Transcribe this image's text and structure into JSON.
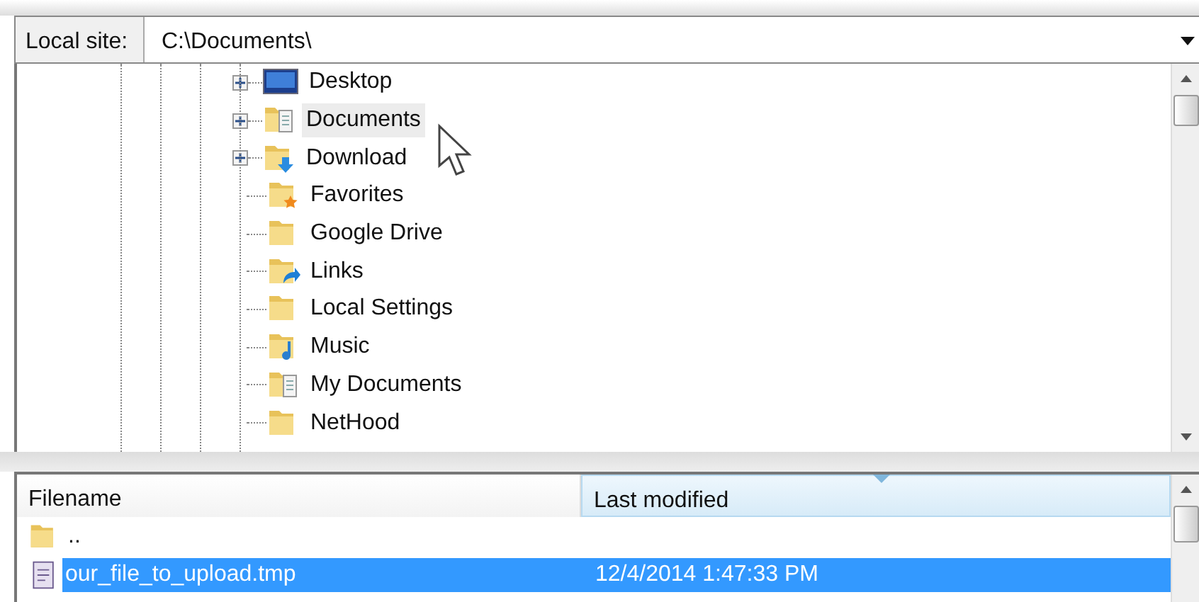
{
  "site_bar": {
    "label": "Local site:",
    "path": "C:\\Documents\\"
  },
  "tree": {
    "items": [
      {
        "label": "Desktop",
        "kind": "desktop",
        "expandable": true,
        "hovered": false
      },
      {
        "label": "Documents",
        "kind": "documents",
        "expandable": true,
        "hovered": true
      },
      {
        "label": "Download",
        "kind": "download",
        "expandable": true,
        "hovered": false
      },
      {
        "label": "Favorites",
        "kind": "star",
        "expandable": false,
        "hovered": false
      },
      {
        "label": "Google Drive",
        "kind": "plain",
        "expandable": false,
        "hovered": false
      },
      {
        "label": "Links",
        "kind": "link",
        "expandable": false,
        "hovered": false
      },
      {
        "label": "Local Settings",
        "kind": "plain",
        "expandable": false,
        "hovered": false
      },
      {
        "label": "Music",
        "kind": "music",
        "expandable": false,
        "hovered": false
      },
      {
        "label": "My Documents",
        "kind": "documents",
        "expandable": false,
        "hovered": false
      },
      {
        "label": "NetHood",
        "kind": "plain",
        "expandable": false,
        "hovered": false
      }
    ]
  },
  "file_list": {
    "columns": [
      {
        "label": "Filename",
        "sorted": false
      },
      {
        "label": "Last modified",
        "sorted": true
      }
    ],
    "rows": [
      {
        "name": "..",
        "modified": "",
        "kind": "folder",
        "selected": false
      },
      {
        "name": "our_file_to_upload.tmp",
        "modified": "12/4/2014 1:47:33 PM",
        "kind": "file",
        "selected": true
      }
    ]
  }
}
